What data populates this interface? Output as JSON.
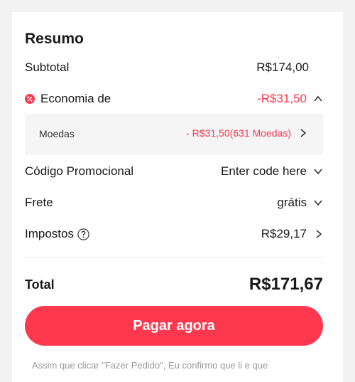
{
  "summary": {
    "title": "Resumo",
    "subtotal_label": "Subtotal",
    "subtotal_value": "R$174,00",
    "savings_label": "Economia de",
    "savings_value": "-R$31,50",
    "coins_label": "Moedas",
    "coins_value": "- R$31,50(631 Moedas)",
    "promo_label": "Código Promocional",
    "promo_value": "Enter code here",
    "shipping_label": "Frete",
    "shipping_value": "grátis",
    "taxes_label": "Impostos",
    "taxes_value": "R$29,17",
    "total_label": "Total",
    "total_value": "R$171,67",
    "pay_button": "Pagar agora",
    "footnote": "Assim que clicar \"Fazer Pedido\", Eu confirmo que li e que"
  },
  "colors": {
    "accent": "#fd384f",
    "text": "#191919",
    "muted": "#999999"
  },
  "icons": {
    "discount": "discount-badge-icon",
    "help": "question-circle-icon",
    "expand": "chevron-down-icon",
    "collapse": "chevron-up-icon",
    "navigate": "chevron-right-icon"
  }
}
